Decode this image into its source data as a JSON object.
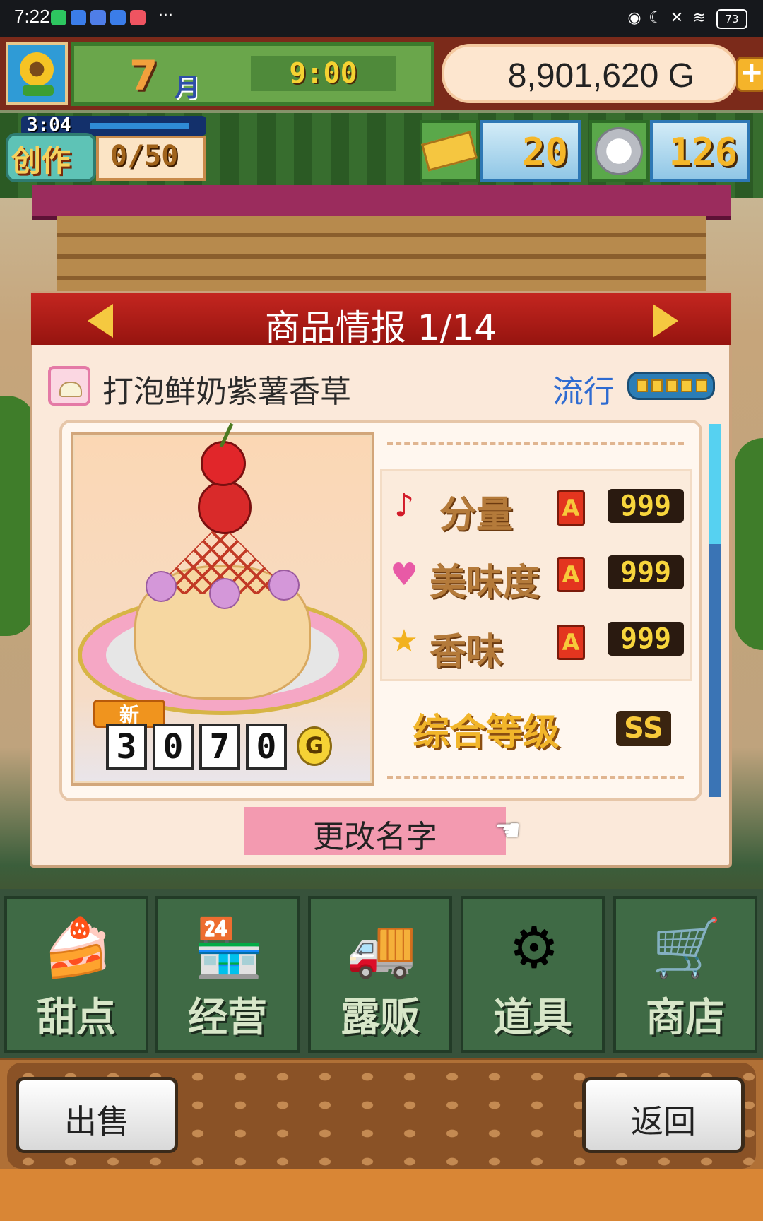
{
  "status_bar": {
    "time": "7:22",
    "more": "···",
    "battery": "73"
  },
  "hud": {
    "month_number": "7",
    "month_suffix": "月",
    "clock": "9:00",
    "money": "8,901,620 G",
    "add_symbol": "+",
    "create": {
      "timer": "3:04",
      "label": "创作",
      "count": "0/50"
    },
    "tickets": "20",
    "medals": "126"
  },
  "panel": {
    "title": "商品情报 1/14",
    "product_name": "打泡鲜奶紫薯香草",
    "trend_label": "流行",
    "trend_level": 5,
    "new_tag": "新",
    "price_digits": [
      "3",
      "0",
      "7",
      "0"
    ],
    "price_unit": "G",
    "stats": [
      {
        "icon": "music-note-icon",
        "label": "分量",
        "grade": "A",
        "value": "999"
      },
      {
        "icon": "heart-icon",
        "label": "美味度",
        "grade": "A",
        "value": "999"
      },
      {
        "icon": "star-icon",
        "label": "香味",
        "grade": "A",
        "value": "999"
      }
    ],
    "overall_label": "综合等级",
    "overall_value": "SS",
    "rename_button": "更改名字"
  },
  "menu": [
    {
      "label": "甜点",
      "icon": "cake-icon"
    },
    {
      "label": "经营",
      "icon": "shop-building-icon"
    },
    {
      "label": "露贩",
      "icon": "food-truck-icon"
    },
    {
      "label": "道具",
      "icon": "gear-bag-icon"
    },
    {
      "label": "商店",
      "icon": "shopping-cart-icon"
    }
  ],
  "bottom": {
    "sell_button": "出售",
    "back_button": "返回"
  },
  "colors": {
    "header_red": "#c42620",
    "trend_blue": "#2e6bd1",
    "rename_pink": "#f39ab0",
    "menu_green": "#3f6a45"
  }
}
